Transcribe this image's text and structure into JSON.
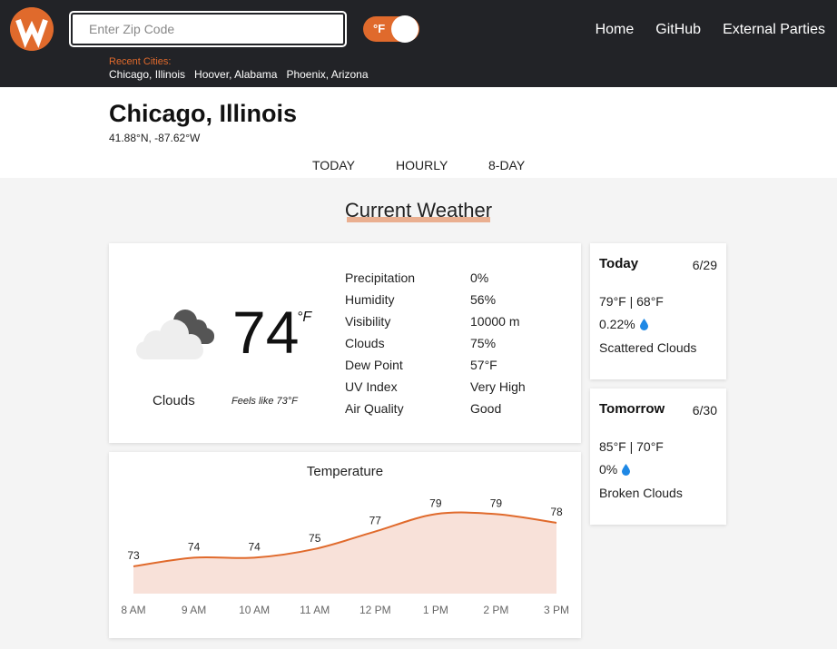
{
  "header": {
    "zip_placeholder": "Enter Zip Code",
    "unit_toggle": "°F",
    "recent_label": "Recent Cities:",
    "recent_cities": [
      "Chicago, Illinois",
      "Hoover, Alabama",
      "Phoenix, Arizona"
    ],
    "nav": [
      "Home",
      "GitHub",
      "External Parties"
    ]
  },
  "location": {
    "city": "Chicago, Illinois",
    "coords": "41.88°N, -87.62°W"
  },
  "tabs": [
    "TODAY",
    "HOURLY",
    "8-DAY"
  ],
  "section_title": "Current Weather",
  "current": {
    "condition": "Clouds",
    "temp": "74",
    "unit": "°F",
    "feels_like": "Feels like 73°F",
    "icon": "cloud-icon",
    "details": [
      {
        "label": "Precipitation",
        "value": "0%"
      },
      {
        "label": "Humidity",
        "value": "56%"
      },
      {
        "label": "Visibility",
        "value": "10000 m"
      },
      {
        "label": "Clouds",
        "value": "75%"
      },
      {
        "label": "Dew Point",
        "value": "57°F"
      },
      {
        "label": "UV Index",
        "value": "Very High"
      },
      {
        "label": "Air Quality",
        "value": "Good"
      }
    ]
  },
  "forecast": [
    {
      "title": "Today",
      "date": "6/29",
      "hilo": "79°F | 68°F",
      "precip": "0.22%",
      "desc": "Scattered Clouds"
    },
    {
      "title": "Tomorrow",
      "date": "6/30",
      "hilo": "85°F | 70°F",
      "precip": "0%",
      "desc": "Broken Clouds"
    }
  ],
  "colors": {
    "accent": "#e06a2c",
    "header_bg": "#222327",
    "drop": "#1e88e5",
    "area_fill": "#f8e1d9"
  },
  "chart_data": {
    "type": "area",
    "title": "Temperature",
    "categories": [
      "8 AM",
      "9 AM",
      "10 AM",
      "11 AM",
      "12 PM",
      "1 PM",
      "2 PM",
      "3 PM"
    ],
    "values": [
      73,
      74,
      74,
      75,
      77,
      79,
      79,
      78
    ],
    "grid": false
  }
}
